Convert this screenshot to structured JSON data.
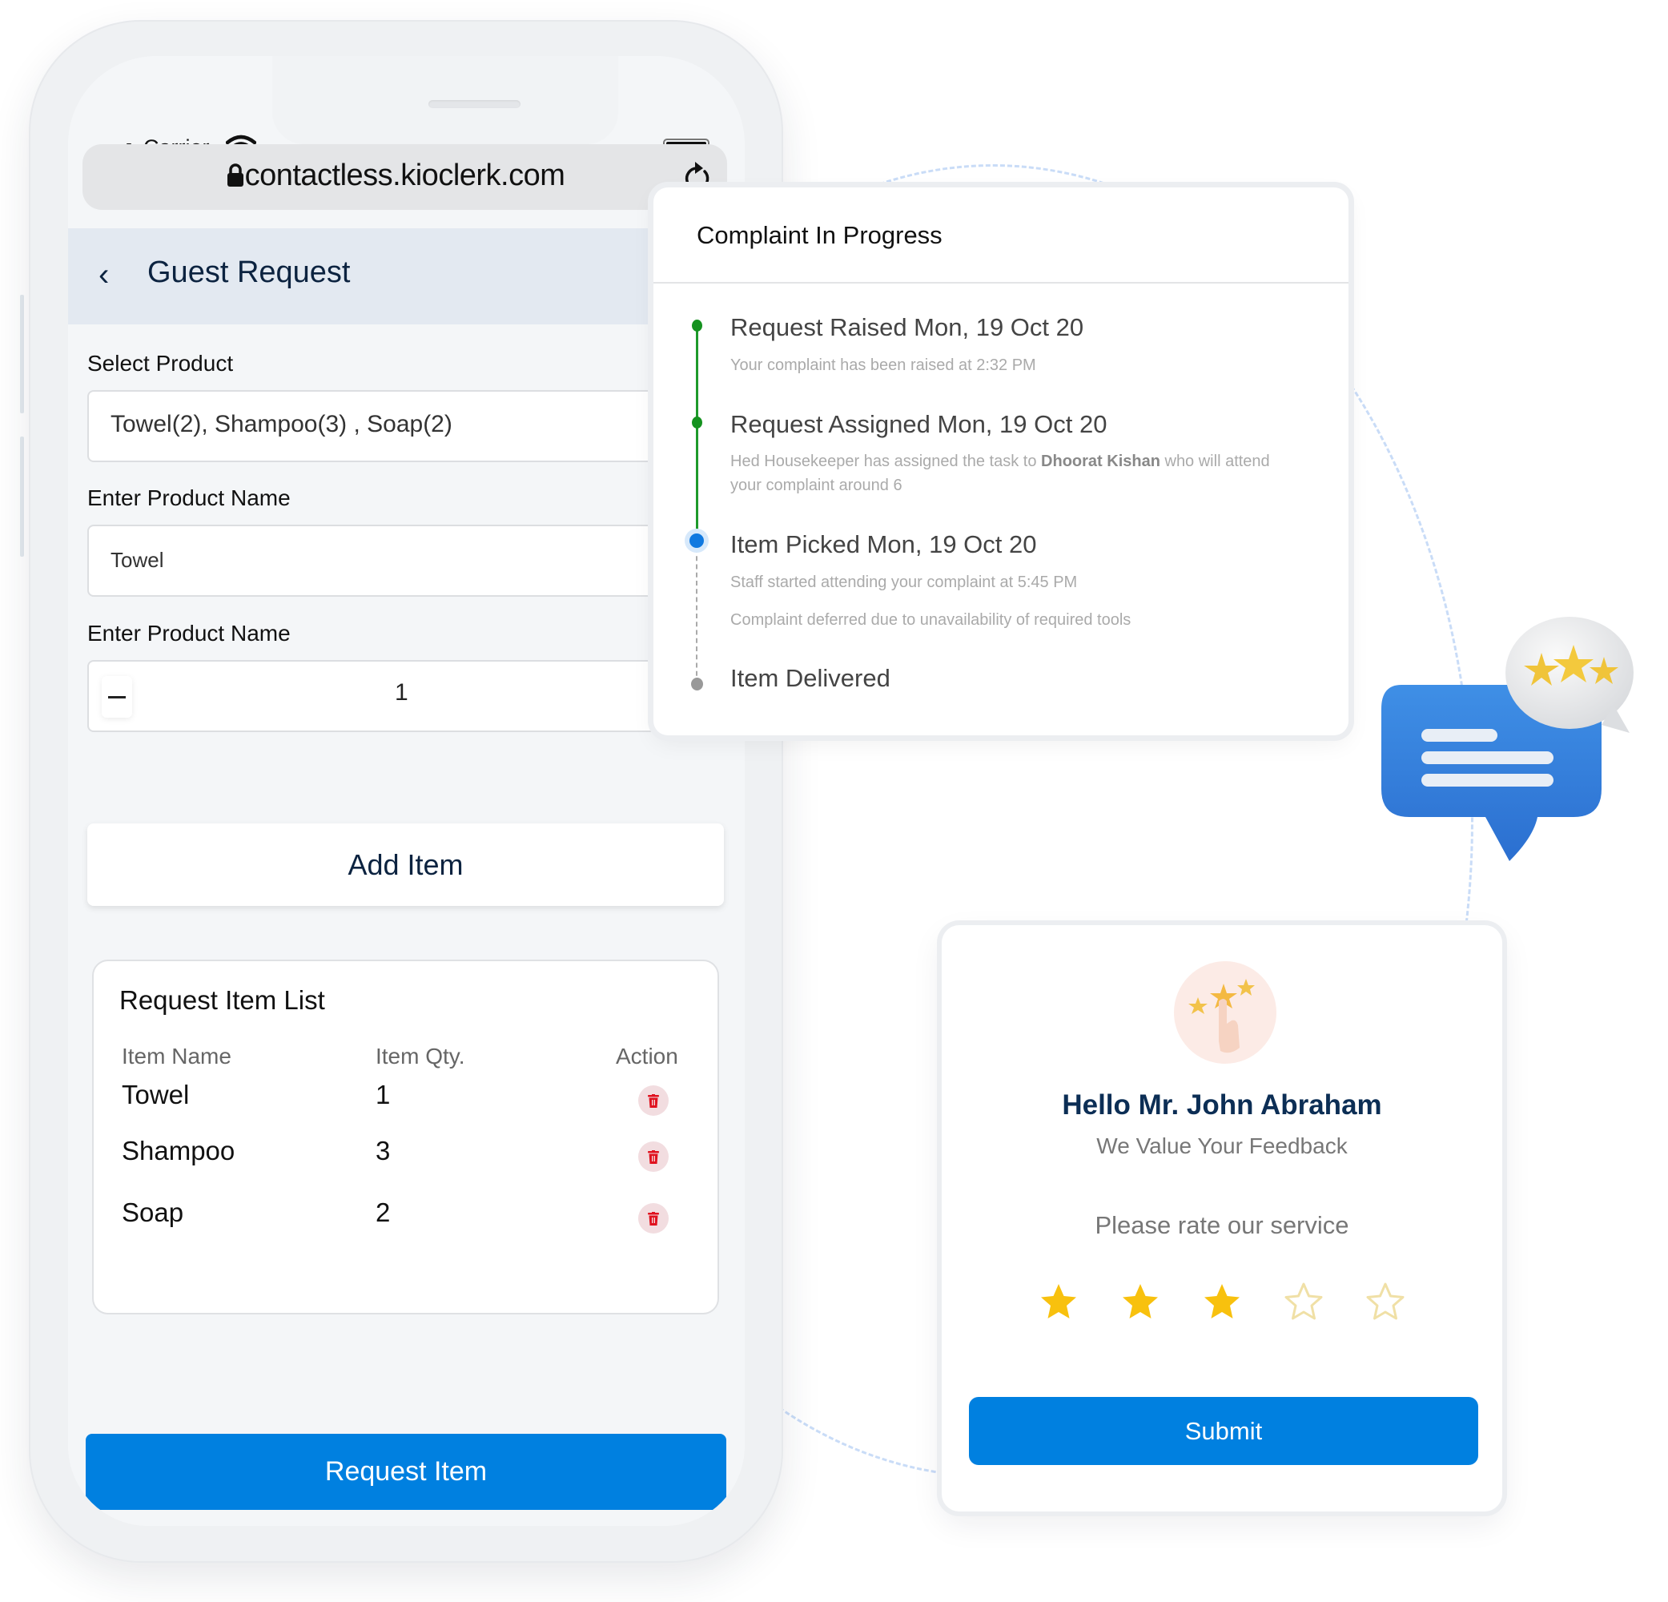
{
  "phone": {
    "status_bar": {
      "carrier": "Carrier",
      "icons": [
        "signal-icon",
        "wifi-icon",
        "battery-icon"
      ]
    },
    "browser": {
      "url": "contactless.kioclerk.com",
      "icons": [
        "lock-icon",
        "reload-icon"
      ]
    },
    "header": {
      "back_icon": "chevron-left-icon",
      "title": "Guest Request"
    },
    "form": {
      "select_product": {
        "label": "Select Product",
        "value": "Towel(2),  Shampoo(3) , Soap(2)"
      },
      "product_name": {
        "label": "Enter Product Name",
        "value": "Towel"
      },
      "quantity": {
        "label": "Enter Product Name",
        "value": "1",
        "decrement_icon": "minus-icon"
      },
      "add_item_label": "Add Item"
    },
    "request_list": {
      "title": "Request Item List",
      "columns": [
        "Item Name",
        "Item Qty.",
        "Action"
      ],
      "rows": [
        {
          "name": "Towel",
          "qty": "1",
          "action_icon": "trash-icon"
        },
        {
          "name": "Shampoo",
          "qty": "3",
          "action_icon": "trash-icon"
        },
        {
          "name": "Soap",
          "qty": "2",
          "action_icon": "trash-icon"
        }
      ]
    },
    "request_button_label": "Request Item"
  },
  "complaint": {
    "title": "Complaint In Progress",
    "steps": [
      {
        "title": "Request Raised Mon, 19 Oct 20",
        "status": "done",
        "desc": "Your complaint has been raised at 2:32 PM"
      },
      {
        "title": "Request Assigned Mon, 19 Oct 20",
        "status": "done",
        "desc_pre": "Hed Housekeeper has assigned the task to ",
        "desc_bold": "Dhoorat Kishan",
        "desc_post": " who will attend your complaint around 6"
      },
      {
        "title": "Item Picked Mon, 19 Oct 20",
        "status": "current",
        "desc": "Staff started attending your complaint at 5:45 PM",
        "note": "Complaint deferred due to unavailability of required tools"
      },
      {
        "title": "Item Delivered",
        "status": "pending"
      }
    ],
    "colors": {
      "done": "#15921f",
      "current": "#1079e0",
      "pending": "#999999"
    }
  },
  "feedback": {
    "icon": "rating-hand-icon",
    "greeting": "Hello Mr. John Abraham",
    "subtitle": "We Value Your Feedback",
    "prompt": "Please rate our service",
    "rating": 3,
    "max_rating": 5,
    "submit_label": "Submit",
    "star_color": "#f8c10e"
  },
  "decoration": {
    "bubble_icon": "chat-review-bubble-icon"
  },
  "colors": {
    "primary": "#0080e0",
    "heading": "#0c2340",
    "danger": "#e0121f"
  }
}
